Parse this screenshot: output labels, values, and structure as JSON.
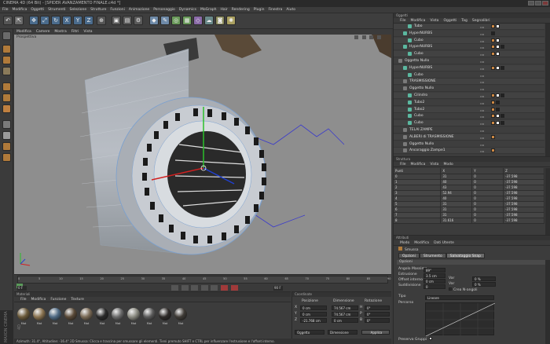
{
  "window": {
    "title": "CINEMA 4D (64 Bit) - [SPIDER AVANZAMENTO FINALE.c4d *]"
  },
  "menubar": [
    "File",
    "Modifica",
    "Oggetti",
    "Strumenti",
    "Selezione",
    "Strutture",
    "Funzioni",
    "Animazione",
    "Personaggio",
    "Dynamics",
    "MoGraph",
    "Hair",
    "Rendering",
    "Plugin",
    "Finestra",
    "Aiuto"
  ],
  "toolbar": {
    "axes": [
      "X",
      "Y",
      "Z"
    ]
  },
  "viewport": {
    "menu": [
      "Modifica",
      "Camere",
      "Mostra",
      "Filtri",
      "Vista"
    ],
    "label": "Prospettiva"
  },
  "timeline": {
    "ticks": [
      "0",
      "5",
      "10",
      "15",
      "20",
      "25",
      "30",
      "35",
      "40",
      "45",
      "50",
      "55",
      "60",
      "65",
      "70",
      "75",
      "80",
      "85",
      "90"
    ],
    "start": "0 F",
    "end": "90 F"
  },
  "materials": {
    "title": "Materiali",
    "menu": [
      "File",
      "Modifica",
      "Funzione",
      "Texture"
    ],
    "items": [
      {
        "name": "Mat",
        "color": "#6b5a3a"
      },
      {
        "name": "Mat",
        "color": "#8a7350"
      },
      {
        "name": "Mat",
        "color": "#4f6a84"
      },
      {
        "name": "Mat",
        "color": "#5a4a38"
      },
      {
        "name": "Mat",
        "color": "#7a6a56"
      },
      {
        "name": "Mat",
        "color": "#2a2a2a"
      },
      {
        "name": "Mat",
        "color": "#6a6a6a"
      },
      {
        "name": "Mat",
        "color": "#8a8a80"
      },
      {
        "name": "Mat",
        "color": "#5a5a5a"
      },
      {
        "name": "Mat",
        "color": "#2e2a28"
      },
      {
        "name": "Mat",
        "color": "#3f3b36"
      }
    ]
  },
  "coordinates": {
    "title": "Coordinate",
    "headers": [
      "Posizione",
      "Dimensione",
      "Rotazione"
    ],
    "rows": [
      {
        "axis": "X",
        "pos": "0 cm",
        "dim": "74.567 cm",
        "rotaxis": "H",
        "rot": "0°"
      },
      {
        "axis": "Y",
        "pos": "0 cm",
        "dim": "74.567 cm",
        "rotaxis": "P",
        "rot": "0°"
      },
      {
        "axis": "Z",
        "pos": "-21.768 cm",
        "dim": "0 cm",
        "rotaxis": "B",
        "rot": "0°"
      }
    ],
    "mode1": "Oggetto",
    "mode2": "Dimensione",
    "apply": "Applica"
  },
  "status": "Azimuth: 31.4°, Altitudine: -16.4°  2D  Smussa: Clicca e trascina per smussare gli elementi. Tieni premuto SHIFT e CTRL per influenzare l'estrusione e l'offset interno.",
  "brand": "MAXON CINEMA 4D",
  "object_manager": {
    "title": "Oggetti",
    "menu": [
      "File",
      "Modifica",
      "Vista",
      "Oggetti",
      "Tag",
      "Segnalibri"
    ],
    "rows": [
      {
        "name": "Tubo",
        "indent": 2,
        "color": "#5bb8a0",
        "tags": [
          "#cc8844",
          "#ffffff"
        ]
      },
      {
        "name": "HyperNURBS",
        "indent": 1,
        "color": "#5bb8a0",
        "tags": [
          "#222222"
        ]
      },
      {
        "name": "Cubo",
        "indent": 2,
        "color": "#5bb8a0",
        "tags": [
          "#cc8844",
          "#ffffff"
        ]
      },
      {
        "name": "HyperNURBS",
        "indent": 1,
        "color": "#5bb8a0",
        "tags": [
          "#cc8844",
          "#ffffff",
          "#222222"
        ]
      },
      {
        "name": "Cubo",
        "indent": 2,
        "color": "#5bb8a0",
        "tags": [
          "#cc8844",
          "#ffffff"
        ]
      },
      {
        "name": "Oggetto Nullo",
        "indent": 0,
        "color": "#7a7a7a",
        "tags": []
      },
      {
        "name": "HyperNURBS",
        "indent": 1,
        "color": "#5bb8a0",
        "tags": [
          "#cc8844",
          "#ffffff",
          "#222222"
        ]
      },
      {
        "name": "Cubo",
        "indent": 2,
        "color": "#5bb8a0",
        "tags": []
      },
      {
        "name": "TRASMISSIONE",
        "indent": 1,
        "color": "#7a7a7a",
        "tags": []
      },
      {
        "name": "Oggetto Nullo",
        "indent": 1,
        "color": "#7a7a7a",
        "tags": []
      },
      {
        "name": "Cilindro",
        "indent": 2,
        "color": "#5bb8a0",
        "tags": [
          "#cc8844",
          "#ffffff",
          "#222222"
        ]
      },
      {
        "name": "Tubo2",
        "indent": 2,
        "color": "#5bb8a0",
        "tags": [
          "#cc8844",
          "#222222"
        ]
      },
      {
        "name": "Tubo2",
        "indent": 2,
        "color": "#5bb8a0",
        "tags": [
          "#cc8844",
          "#222222"
        ]
      },
      {
        "name": "Cubo",
        "indent": 2,
        "color": "#5bb8a0",
        "tags": [
          "#cc8844",
          "#ffffff",
          "#222222"
        ]
      },
      {
        "name": "Cubo",
        "indent": 2,
        "color": "#5bb8a0",
        "tags": [
          "#cc8844",
          "#ffffff",
          "#222222"
        ]
      },
      {
        "name": "TELAI ZAMPE",
        "indent": 1,
        "color": "#7a7a7a",
        "tags": []
      },
      {
        "name": "ALBERI di TRASMISSIONE",
        "indent": 1,
        "color": "#7a7a7a",
        "tags": [
          "#cc8844"
        ]
      },
      {
        "name": "Oggetto Nullo",
        "indent": 1,
        "color": "#7a7a7a",
        "tags": []
      },
      {
        "name": "Ancoraggio Zampe1",
        "indent": 1,
        "color": "#7a7a7a",
        "tags": [
          "#cc8844"
        ]
      }
    ]
  },
  "structure": {
    "title": "Struttura",
    "menu": [
      "File",
      "Modifica",
      "Vista",
      "Modo"
    ],
    "headers": [
      "Punti",
      "X",
      "Y",
      "Z"
    ],
    "rows": [
      [
        "0",
        "31",
        "0",
        "-37.598"
      ],
      [
        "1",
        "40",
        "0",
        "-37.598"
      ],
      [
        "2",
        "43",
        "0",
        "-37.598"
      ],
      [
        "3",
        "52.94",
        "0",
        "-37.598"
      ],
      [
        "4",
        "40",
        "0",
        "-37.598"
      ],
      [
        "5",
        "31",
        "0",
        "-37.598"
      ],
      [
        "6",
        "31",
        "0",
        "-37.598"
      ],
      [
        "7",
        "31",
        "0",
        "-37.598"
      ],
      [
        "8",
        "31.616",
        "0",
        "-37.598"
      ]
    ]
  },
  "attributes": {
    "title": "Attributi",
    "menu": [
      "Modo",
      "Modifica",
      "Dati Utente"
    ],
    "tool": "Smussa",
    "tabs": [
      "Opzioni",
      "Strumento",
      "Salvataggio Snap"
    ],
    "section": "Opzioni",
    "fields": [
      {
        "label": "Angolo Massimo",
        "value": "89°"
      },
      {
        "label": "Estrusione",
        "value": "3.5 cm"
      },
      {
        "label": "Offset interno",
        "value": "0 cm"
      },
      {
        "label": "Suddivisione",
        "value": "0"
      }
    ],
    "var_label": "Var",
    "var_values": [
      "0 %",
      "0 %"
    ],
    "checkbox_label": "Crea N-angoli",
    "type_label": "Tipo",
    "type_value": "Lineare",
    "curve_label": "Percorso",
    "preserve_label": "Preserva Gruppi"
  }
}
